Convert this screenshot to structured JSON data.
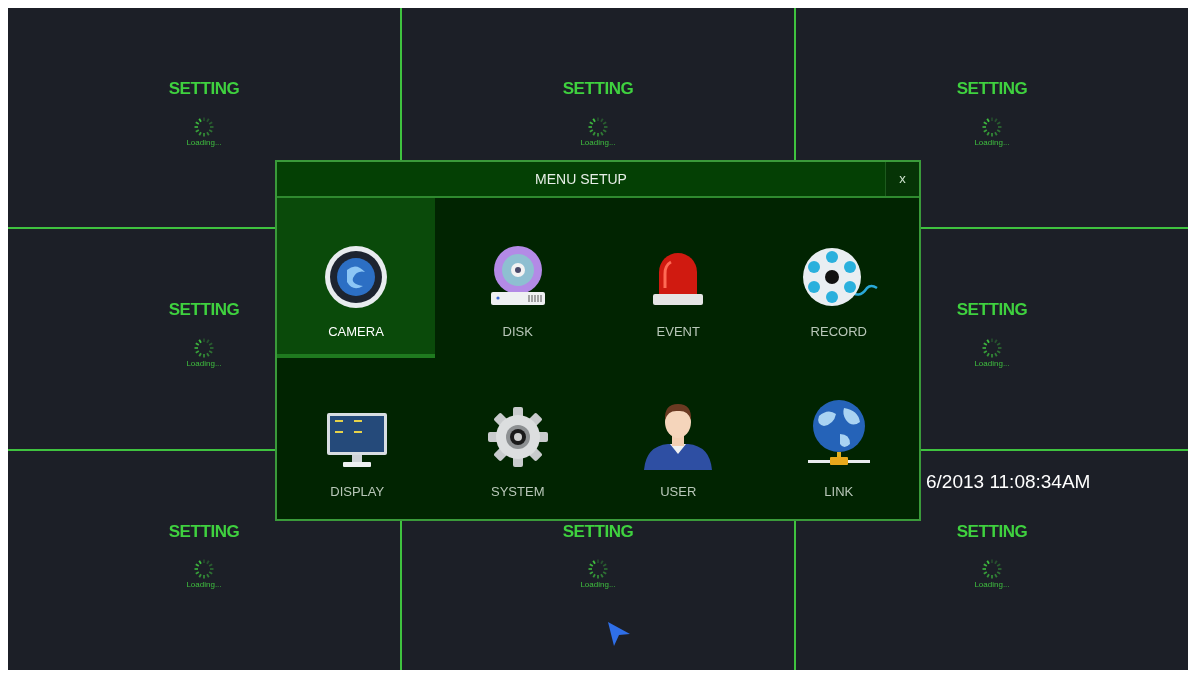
{
  "tiles": [
    {
      "label": "SETTING",
      "status": "Loading..."
    },
    {
      "label": "SETTING",
      "status": "Loading..."
    },
    {
      "label": "SETTING",
      "status": "Loading..."
    },
    {
      "label": "SETTING",
      "status": "Loading..."
    },
    {
      "label": "SETTING",
      "status": "Loading..."
    },
    {
      "label": "SETTING",
      "status": "Loading..."
    },
    {
      "label": "SETTING",
      "status": "Loading..."
    },
    {
      "label": "SETTING",
      "status": "Loading..."
    }
  ],
  "datetime": "6/2013 11:08:34AM",
  "dialog": {
    "title": "MENU SETUP",
    "close": "x",
    "items": [
      {
        "kind": "camera",
        "label": "CAMERA",
        "selected": true
      },
      {
        "kind": "disk",
        "label": "DISK",
        "selected": false
      },
      {
        "kind": "event",
        "label": "EVENT",
        "selected": false
      },
      {
        "kind": "record",
        "label": "RECORD",
        "selected": false
      },
      {
        "kind": "display",
        "label": "DISPLAY",
        "selected": false
      },
      {
        "kind": "system",
        "label": "SYSTEM",
        "selected": false
      },
      {
        "kind": "user",
        "label": "USER",
        "selected": false
      },
      {
        "kind": "link",
        "label": "LINK",
        "selected": false
      }
    ]
  }
}
